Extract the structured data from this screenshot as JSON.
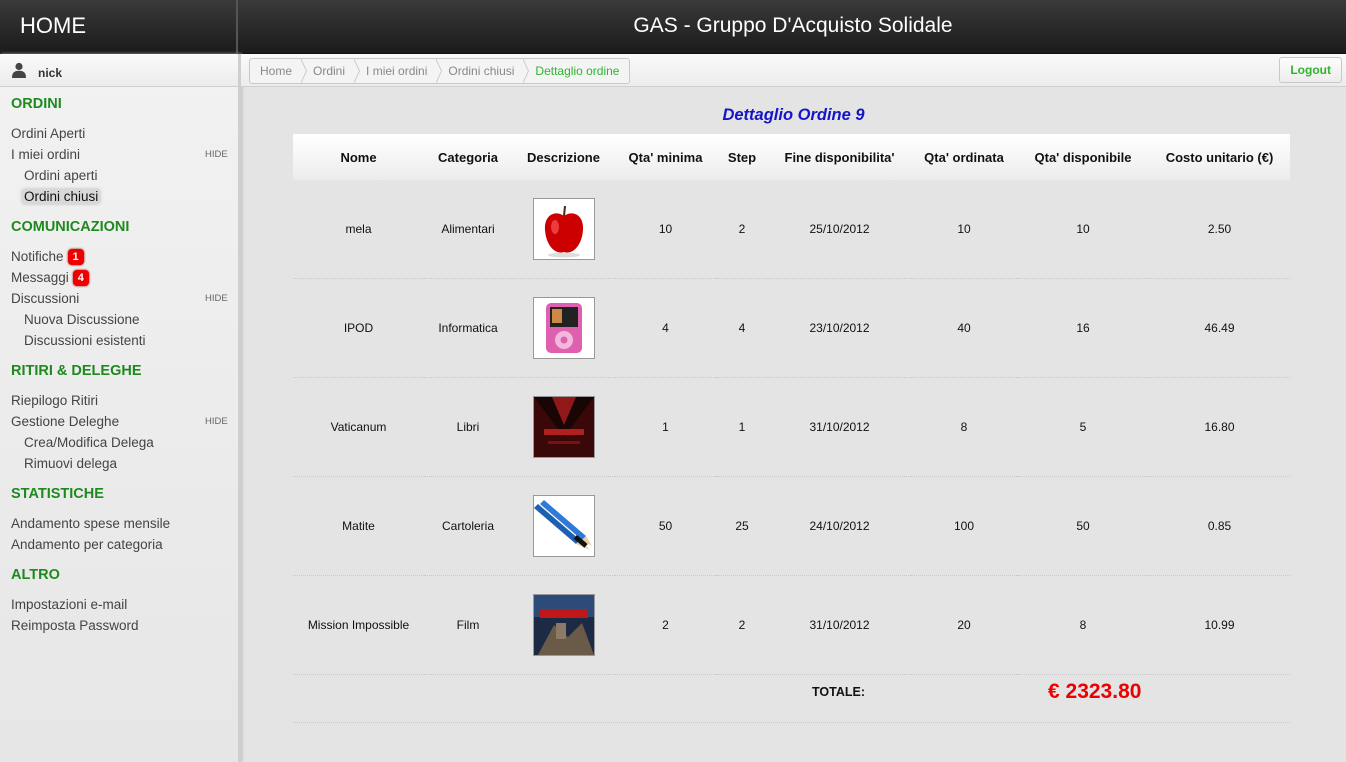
{
  "header": {
    "home_label": "HOME",
    "app_title": "GAS - Gruppo D'Acquisto Solidale"
  },
  "user": {
    "name": "nick",
    "icon": "user-icon"
  },
  "sidebar": {
    "hide_label": "HIDE",
    "ordini": {
      "title": "ORDINI",
      "ordini_aperti": "Ordini Aperti",
      "miei_ordini": "I miei ordini",
      "sub_ordini_aperti": "Ordini aperti",
      "sub_ordini_chiusi": "Ordini chiusi"
    },
    "comunicazioni": {
      "title": "COMUNICAZIONI",
      "notifiche": "Notifiche",
      "notifiche_count": "1",
      "messaggi": "Messaggi",
      "messaggi_count": "4",
      "discussioni": "Discussioni",
      "nuova_discussione": "Nuova Discussione",
      "discussioni_esistenti": "Discussioni esistenti"
    },
    "ritiri": {
      "title": "RITIRI & DELEGHE",
      "riepilogo": "Riepilogo Ritiri",
      "gestione": "Gestione Deleghe",
      "crea": "Crea/Modifica Delega",
      "rimuovi": "Rimuovi delega"
    },
    "statistiche": {
      "title": "STATISTICHE",
      "mensile": "Andamento spese mensile",
      "categoria": "Andamento per categoria"
    },
    "altro": {
      "title": "ALTRO",
      "email": "Impostazioni e-mail",
      "password": "Reimposta Password"
    }
  },
  "breadcrumb": {
    "home": "Home",
    "ordini": "Ordini",
    "miei_ordini": "I miei ordini",
    "ordini_chiusi": "Ordini chiusi",
    "current": "Dettaglio ordine"
  },
  "logout_label": "Logout",
  "page_title": "Dettaglio Ordine 9",
  "table": {
    "headers": {
      "nome": "Nome",
      "categoria": "Categoria",
      "descrizione": "Descrizione",
      "qta_minima": "Qta' minima",
      "step": "Step",
      "fine": "Fine disponibilita'",
      "qta_ordinata": "Qta' ordinata",
      "qta_disponibile": "Qta' disponibile",
      "costo": "Costo unitario (€)"
    },
    "rows": [
      {
        "nome": "mela",
        "categoria": "Alimentari",
        "image": "apple-image",
        "qta_minima": "10",
        "step": "2",
        "fine": "25/10/2012",
        "qta_ordinata": "10",
        "qta_disponibile": "10",
        "costo": "2.50"
      },
      {
        "nome": "IPOD",
        "categoria": "Informatica",
        "image": "ipod-image",
        "qta_minima": "4",
        "step": "4",
        "fine": "23/10/2012",
        "qta_ordinata": "40",
        "qta_disponibile": "16",
        "costo": "46.49"
      },
      {
        "nome": "Vaticanum",
        "categoria": "Libri",
        "image": "book-cover-image",
        "qta_minima": "1",
        "step": "1",
        "fine": "31/10/2012",
        "qta_ordinata": "8",
        "qta_disponibile": "5",
        "costo": "16.80"
      },
      {
        "nome": "Matite",
        "categoria": "Cartoleria",
        "image": "pencils-image",
        "qta_minima": "50",
        "step": "25",
        "fine": "24/10/2012",
        "qta_ordinata": "100",
        "qta_disponibile": "50",
        "costo": "0.85"
      },
      {
        "nome": "Mission Impossible",
        "categoria": "Film",
        "image": "movie-cover-image",
        "qta_minima": "2",
        "step": "2",
        "fine": "31/10/2012",
        "qta_ordinata": "20",
        "qta_disponibile": "8",
        "costo": "10.99"
      }
    ],
    "total_label": "TOTALE:",
    "total_value": "€ 2323.80"
  },
  "colors": {
    "section_green": "#1e8a1e",
    "title_blue": "#1414c8",
    "total_red": "#e00000",
    "badge_red": "#e00000"
  }
}
